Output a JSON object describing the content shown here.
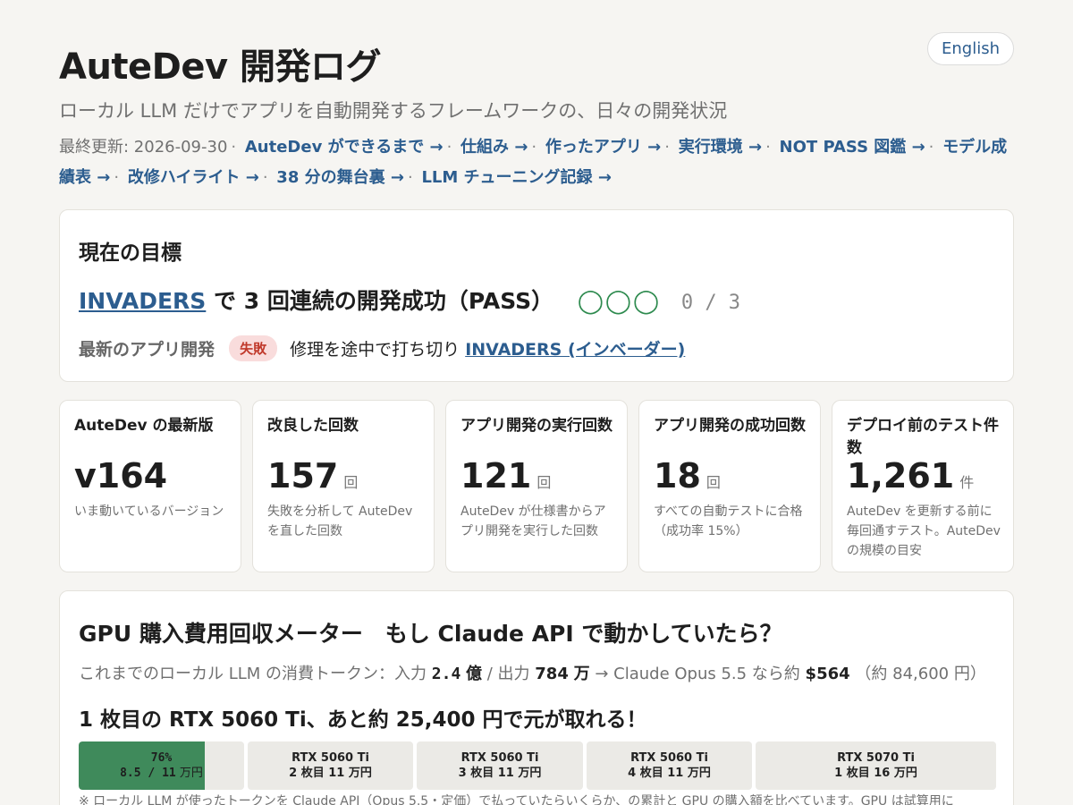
{
  "header": {
    "title": "AuteDev 開発ログ",
    "lang_button": "English",
    "subtitle": "ローカル LLM だけでアプリを自動開発するフレームワークの、日々の開発状況",
    "updated": "最終更新: 2026-09-30",
    "nav_links": [
      "AuteDev ができるまで →",
      "仕組み →",
      "作ったアプリ →",
      "実行環境 →",
      "NOT PASS 図鑑 →",
      "モデル成績表 →",
      "改修ハイライト →",
      "38 分の舞台裏 →",
      "LLM チューニング記録 →"
    ]
  },
  "goal": {
    "heading": "現在の目標",
    "target_link": "INVADERS",
    "target_text": " で 3 回連続の開発成功（PASS）",
    "circles": "◯◯◯",
    "progress": "0 / 3",
    "latest_label": "最新のアプリ開発",
    "latest_badge": "失敗",
    "latest_text": "修理を途中で打ち切り",
    "latest_link": "INVADERS (インベーダー)"
  },
  "stats": [
    {
      "label": "AuteDev の最新版",
      "value": "v164",
      "unit": "",
      "desc": "いま動いているバージョン"
    },
    {
      "label": "改良した回数",
      "value": "157",
      "unit": "回",
      "desc": "失敗を分析して AuteDev を直した回数"
    },
    {
      "label": "アプリ開発の実行回数",
      "value": "121",
      "unit": "回",
      "desc": "AuteDev が仕様書からアプリ開発を実行した回数"
    },
    {
      "label": "アプリ開発の成功回数",
      "value": "18",
      "unit": "回",
      "desc": "すべての自動テストに合格（成功率 15%）"
    },
    {
      "label": "デプロイ前のテスト件数",
      "value": "1,261",
      "unit": "件",
      "desc": "AuteDev を更新する前に毎回通すテスト。AuteDev の規模の目安"
    }
  ],
  "gpu": {
    "heading": "GPU 購入費用回収メーター　もし Claude API で動かしていたら？",
    "tokens_prefix": "これまでのローカル LLM の消費トークン：入力",
    "input_value": "2.4",
    "input_unit": "億",
    "output_label": "/ 出力",
    "output_value": "784",
    "output_unit": "万",
    "convert_text": "→ Claude Opus 5.5 なら約",
    "cost": "$564",
    "cost_yen": "（約 84,600 円）",
    "goal_text": "1 枚目の RTX 5060 Ti、あと約 25,400 円で元が取れる！",
    "meter": [
      {
        "line1": "76%",
        "line2": "8.5 / 11",
        "line2_unit": "万円",
        "fill": 0.76,
        "accent": "#3f8a5b"
      },
      {
        "line1": "RTX 5060 Ti",
        "line2": "2 枚目 11 万円",
        "fill": 0
      },
      {
        "line1": "RTX 5060 Ti",
        "line2": "3 枚目 11 万円",
        "fill": 0
      },
      {
        "line1": "RTX 5060 Ti",
        "line2": "4 枚目 11 万円",
        "fill": 0
      },
      {
        "line1": "RTX 5070 Ti",
        "line2": "1 枚目 16 万円",
        "fill": 0
      }
    ],
    "footnote": "※ ローカル LLM が使ったトークンを Claude API（Opus 5.5・定価）で払っていたらいくらか、の累計と GPU の購入額を比べています。GPU は試算用に"
  },
  "colors": {
    "accent_link": "#2c5d8f",
    "success_green": "#3f8a5b",
    "fail_red": "#c0392b"
  }
}
